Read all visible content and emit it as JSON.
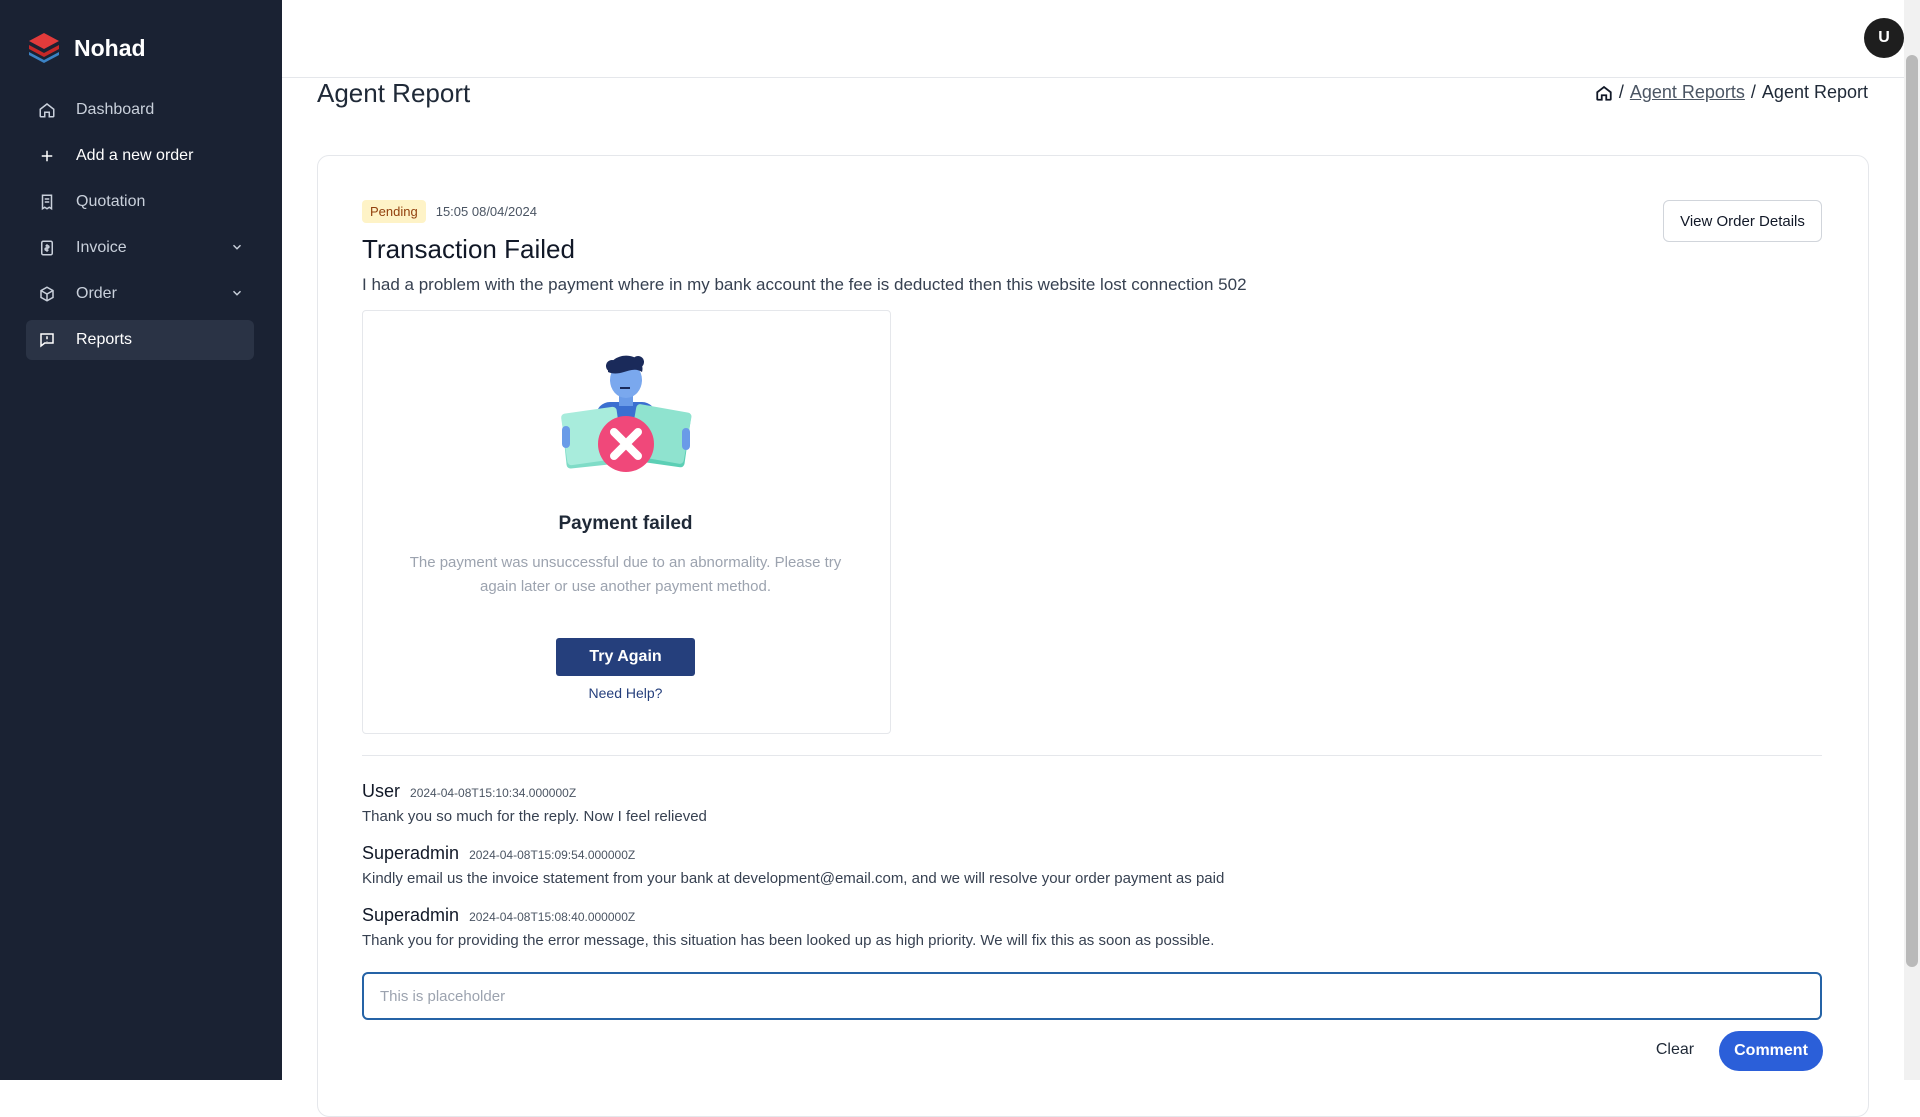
{
  "app": {
    "name": "Nohad"
  },
  "sidebar": {
    "items": [
      {
        "label": "Dashboard",
        "icon": "home-icon"
      },
      {
        "label": "Add a new order",
        "icon": "plus-icon"
      },
      {
        "label": "Quotation",
        "icon": "receipt-icon"
      },
      {
        "label": "Invoice",
        "icon": "invoice-icon"
      },
      {
        "label": "Order",
        "icon": "package-icon"
      },
      {
        "label": "Reports",
        "icon": "message-icon"
      }
    ]
  },
  "header": {
    "avatar_initial": "U"
  },
  "page": {
    "title": "Agent Report",
    "breadcrumb": {
      "link": "Agent Reports",
      "current": "Agent Report"
    }
  },
  "report": {
    "status": "Pending",
    "timestamp": "15:05 08/04/2024",
    "title": "Transaction Failed",
    "description": "I had a problem with the payment where in my bank account the fee is deducted then this website lost connection 502",
    "view_button": "View Order Details",
    "attachment": {
      "title": "Payment failed",
      "description": "The payment was unsuccessful due to an abnormality. Please try again later or use another payment method.",
      "button": "Try Again",
      "help": "Need Help?"
    }
  },
  "comments": [
    {
      "author": "User",
      "time": "2024-04-08T15:10:34.000000Z",
      "text": "Thank you so much for the reply. Now I feel relieved"
    },
    {
      "author": "Superadmin",
      "time": "2024-04-08T15:09:54.000000Z",
      "text": "Kindly email us the invoice statement from your bank at development@email.com, and we will resolve your order payment as paid"
    },
    {
      "author": "Superadmin",
      "time": "2024-04-08T15:08:40.000000Z",
      "text": "Thank you for providing the error message, this situation has been looked up as high priority. We will fix this as soon as possible."
    }
  ],
  "comment_form": {
    "placeholder": "This is placeholder",
    "clear_label": "Clear",
    "submit_label": "Comment"
  },
  "colors": {
    "sidebar": "#1a2233",
    "primary": "#2b5fd9",
    "accent": "#253f7c",
    "badge": "#fef3c7"
  }
}
